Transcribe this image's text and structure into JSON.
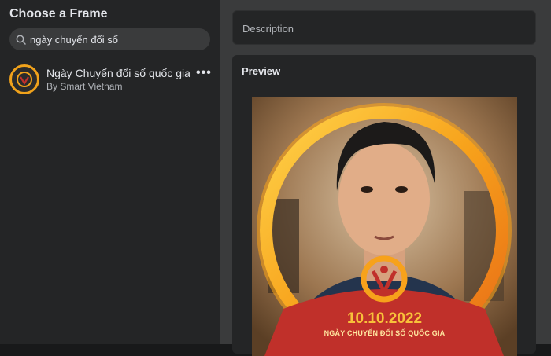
{
  "sidebar": {
    "title": "Choose a Frame",
    "search": {
      "value": "ngày chuyển đổi số",
      "icon": "search-icon"
    },
    "results": [
      {
        "name": "Ngày Chuyển đổi số quốc gia",
        "author": "By Smart Vietnam",
        "more": "•••"
      }
    ]
  },
  "main": {
    "description_placeholder": "Description",
    "preview_title": "Preview",
    "frame": {
      "date": "10.10.2022",
      "caption": "NGÀY CHUYỂN ĐỔI SỐ QUỐC GIA"
    }
  },
  "colors": {
    "accent_orange": "#f0a21b",
    "frame_red": "#c0302a",
    "background": "#18191a",
    "panel": "#242526"
  }
}
